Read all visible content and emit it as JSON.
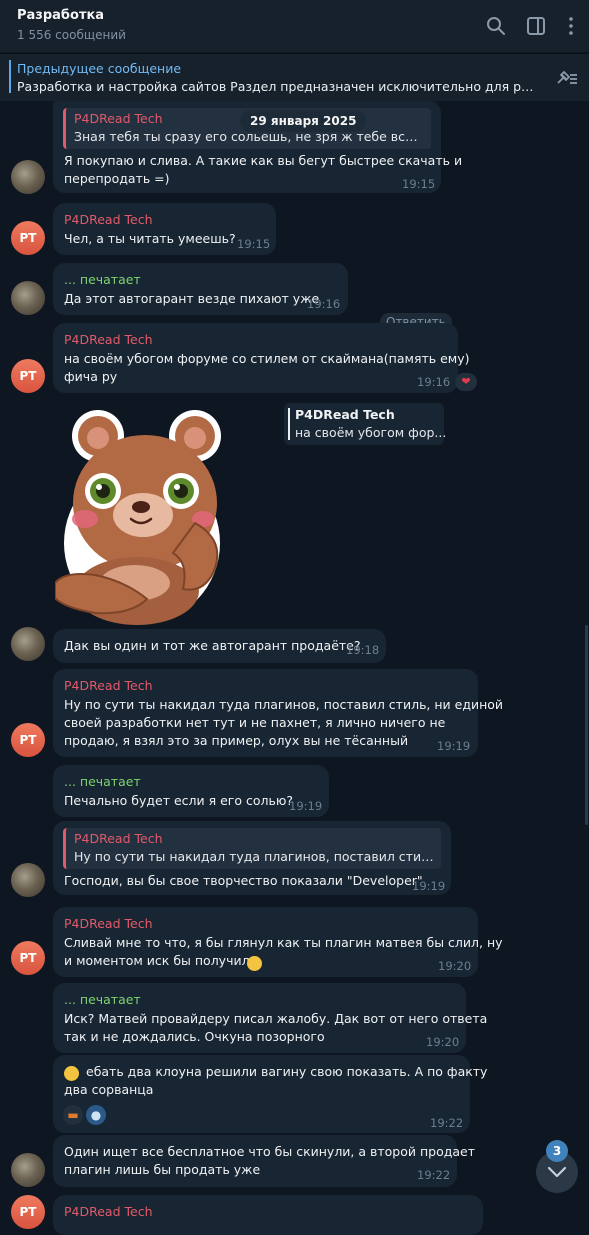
{
  "header": {
    "title": "Разработка",
    "subtitle": "1 556 сообщений",
    "icons": [
      "search-icon",
      "sidebar-toggle-icon",
      "more-vertical-icon"
    ]
  },
  "pinned": {
    "title": "Предыдущее сообщение",
    "text": "Разработка и настройка сайтов  Раздел предназначен исключительно для разме...",
    "icon": "unpin-list-icon"
  },
  "date_pill": "29 января 2025",
  "reply_label": "Ответить",
  "messages": [
    {
      "quote": {
        "name": "P4DRead Tech",
        "text": "Зная тебя ты сразу его сольешь, не зря ж тебе все акк..."
      },
      "lines": [
        "Я покупаю и слива. А такие как вы бегут быстрее скачать и",
        "перепродать =)"
      ],
      "time": "19:15"
    },
    {
      "sender": "P4DRead Tech",
      "lines": [
        "Чел, а ты читать умеешь?"
      ],
      "time": "19:15"
    },
    {
      "typing": "... печатает",
      "lines": [
        "Да этот автогарант везде пихают уже"
      ],
      "time": "19:16"
    },
    {
      "sender": "P4DRead Tech",
      "lines": [
        "на своём убогом форуме со стилем от скаймана(память ему)",
        "фича ру"
      ],
      "time": "19:16",
      "reaction": "❤"
    },
    {
      "sticker_reply": {
        "name": "P4DRead Tech",
        "text": "на своём убогом фор..."
      }
    },
    {
      "lines": [
        "Дак вы один и тот же автогарант продаёте?"
      ],
      "time": "19:18"
    },
    {
      "sender": "P4DRead Tech",
      "lines": [
        "Ну по сути ты накидал туда плагинов, поставил стиль, ни единой",
        "своей разработки нет тут и не пахнет, я лично ничего не",
        "продаю, я взял это за пример, олух вы не тёсанный"
      ],
      "time": "19:19"
    },
    {
      "typing": "... печатает",
      "lines": [
        "Печально будет если я его солью?"
      ],
      "time": "19:19"
    },
    {
      "quote": {
        "name": "P4DRead Tech",
        "text": "Ну по сути ты накидал туда плагинов, поставил стиль, н..."
      },
      "lines": [
        "Господи, вы бы свое творчество показали \"Developer\""
      ],
      "time": "19:19"
    },
    {
      "sender": "P4DRead Tech",
      "lines": [
        "Сливай мне то что, я бы глянул как ты плагин матвея бы слил, ну",
        "и моментом иск бы получил"
      ],
      "time": "19:20"
    },
    {
      "typing": "... печатает",
      "lines": [
        "Иск? Матвей провайдеру писал жалобу. Дак вот от него ответа",
        "так и не дождались. Очкуна позорного"
      ],
      "time": "19:20"
    },
    {
      "lines": [
        "ебать два клоуна решили вагину свою показать. А по факту",
        "два сорванца"
      ],
      "time": "19:22",
      "reactions": [
        "hotdog-emoji",
        "avatar-emoji"
      ]
    },
    {
      "lines": [
        "Один ищет все бесплатное что бы скинули, а второй продает",
        "плагин лишь бы продать уже"
      ],
      "time": "19:22"
    },
    {
      "sender": "P4DRead Tech",
      "lines": []
    }
  ],
  "avatars": {
    "pt_initials": "PT"
  },
  "unread_badge": "3",
  "colors": {
    "background": "#0e1621",
    "bubble": "#182533",
    "header": "#17212b",
    "sender_red": "#e15a6b",
    "typing_green": "#7ed36f",
    "link_blue": "#71baf4",
    "badge_blue": "#4082bc"
  }
}
